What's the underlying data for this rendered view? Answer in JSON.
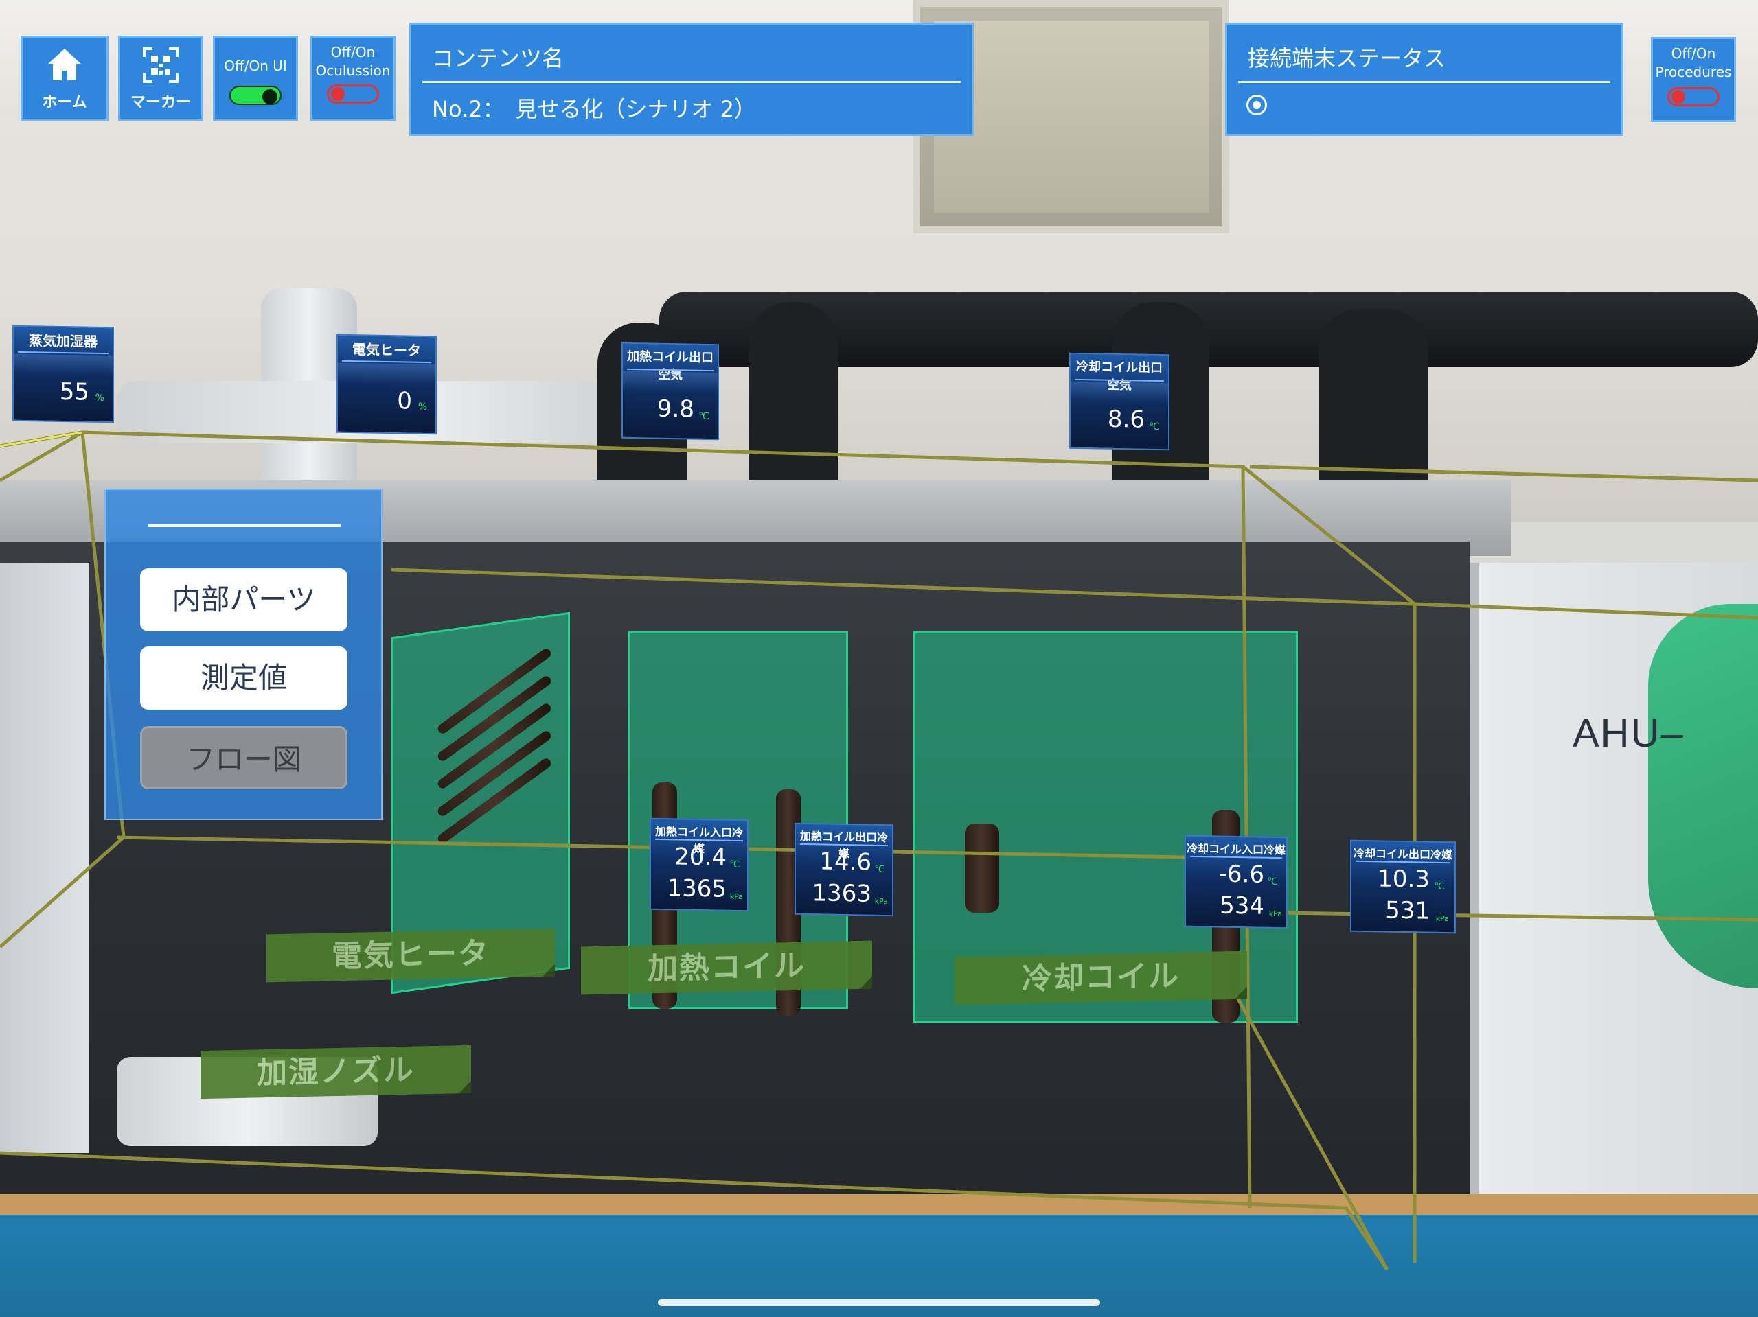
{
  "toolbar": {
    "home_label": "ホーム",
    "marker_label": "マーカー",
    "ui_toggle": {
      "label": "Off/On UI",
      "state": "on"
    },
    "occlusion_toggle": {
      "label_line1": "Off/On",
      "label_line2": "Oculussion",
      "state": "off"
    },
    "procedures_toggle": {
      "label_line1": "Off/On",
      "label_line2": "Procedures",
      "state": "off"
    }
  },
  "content_panel": {
    "title": "コンテンツ名",
    "value": "No.2：　見せる化（シナリオ 2）"
  },
  "status_panel": {
    "title": "接続端末ステータス"
  },
  "side_menu": {
    "items": [
      {
        "label": "内部パーツ",
        "state": "active"
      },
      {
        "label": "測定値",
        "state": "active"
      },
      {
        "label": "フロー図",
        "state": "inactive"
      }
    ]
  },
  "sensors": {
    "steam_humidifier": {
      "name": "蒸気加湿器",
      "value": "55",
      "unit": "%"
    },
    "electric_heater": {
      "name": "電気ヒータ",
      "value": "0",
      "unit": "%"
    },
    "heating_coil_outlet_air": {
      "name": "加熱コイル出口空気",
      "value": "9.8",
      "unit": "℃"
    },
    "cooling_coil_outlet_air": {
      "name": "冷却コイル出口空気",
      "value": "8.6",
      "unit": "℃"
    },
    "heating_coil_inlet_refrigerant": {
      "name": "加熱コイル入口冷媒",
      "temp": "20.4",
      "temp_unit": "℃",
      "pressure": "1365",
      "pressure_unit": "kPa"
    },
    "heating_coil_outlet_refrigerant": {
      "name": "加熱コイル出口冷媒",
      "temp": "14.6",
      "temp_unit": "℃",
      "pressure": "1363",
      "pressure_unit": "kPa"
    },
    "cooling_coil_inlet_refrigerant": {
      "name": "冷却コイル入口冷媒",
      "temp": "-6.6",
      "temp_unit": "℃",
      "pressure": "534",
      "pressure_unit": "kPa"
    },
    "cooling_coil_outlet_refrigerant": {
      "name": "冷却コイル出口冷媒",
      "temp": "10.3",
      "temp_unit": "℃",
      "pressure": "531",
      "pressure_unit": "kPa"
    }
  },
  "components": {
    "electric_heater": "電気ヒータ",
    "heating_coil": "加熱コイル",
    "cooling_coil": "冷却コイル",
    "humidifier_nozzle": "加湿ノズル"
  },
  "equipment_label": "AHU–",
  "colors": {
    "panel_blue": "#2f86dd",
    "toggle_on": "#22e04a",
    "toggle_off": "#e53333",
    "component_green": "#21c88c",
    "label_green": "#4b7d2d",
    "wireframe": "#8f8f3a"
  }
}
